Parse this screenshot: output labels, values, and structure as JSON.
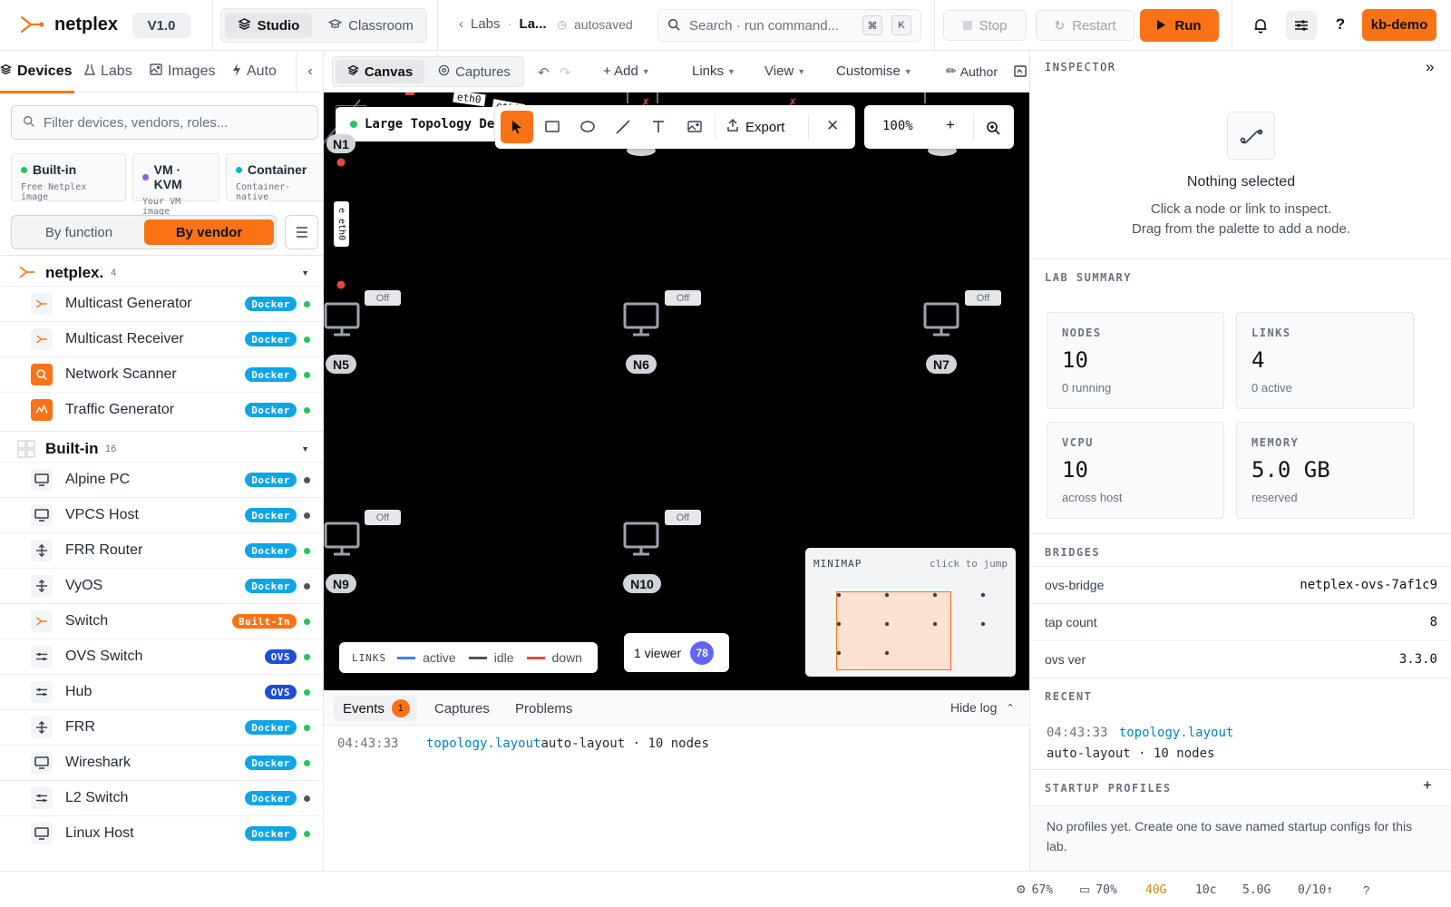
{
  "app": {
    "name": "netplex",
    "version": "V1.0"
  },
  "modes": {
    "studio": "Studio",
    "classroom": "Classroom"
  },
  "breadcrumb": {
    "labs": "Labs",
    "current": "La...",
    "saved": "autosaved"
  },
  "search": {
    "placeholder": "Search · run command...",
    "key1": "⌘",
    "key2": "K"
  },
  "controls": {
    "stop": "Stop",
    "restart": "Restart",
    "run": "Run"
  },
  "user": "kb-demo",
  "left": {
    "tabs": [
      "Devices",
      "Labs",
      "Images",
      "Auto"
    ],
    "filter_placeholder": "Filter devices, vendors, roles...",
    "chips": [
      {
        "title": "Built-in",
        "sub": "Free Netplex image",
        "color": "#22c55e"
      },
      {
        "title": "VM · KVM",
        "sub": "Your VM image",
        "color": "#8b5cf6"
      },
      {
        "title": "Container",
        "sub": "Container-native",
        "color": "#06b6d4"
      }
    ],
    "group_toggle": {
      "by_function": "By function",
      "by_vendor": "By vendor"
    },
    "groups": [
      {
        "name": "netplex.",
        "count": "4"
      },
      {
        "name": "Built-in",
        "count": "16"
      }
    ],
    "devices": [
      {
        "name": "Multicast Generator",
        "badge": "Docker",
        "status": "green"
      },
      {
        "name": "Multicast Receiver",
        "badge": "Docker",
        "status": "green"
      },
      {
        "name": "Network Scanner",
        "badge": "Docker",
        "status": "green"
      },
      {
        "name": "Traffic Generator",
        "badge": "Docker",
        "status": "green"
      },
      {
        "name": "Alpine PC",
        "badge": "Docker",
        "status": "gray"
      },
      {
        "name": "VPCS Host",
        "badge": "Docker",
        "status": "gray"
      },
      {
        "name": "FRR Router",
        "badge": "Docker",
        "status": "green"
      },
      {
        "name": "VyOS",
        "badge": "Docker",
        "status": "gray"
      },
      {
        "name": "Switch",
        "badge": "Built-In",
        "status": "green"
      },
      {
        "name": "OVS Switch",
        "badge": "OVS",
        "status": "green"
      },
      {
        "name": "Hub",
        "badge": "OVS",
        "status": "green"
      },
      {
        "name": "FRR",
        "badge": "Docker",
        "status": "green"
      },
      {
        "name": "Wireshark",
        "badge": "Docker",
        "status": "green"
      },
      {
        "name": "L2 Switch",
        "badge": "Docker",
        "status": "gray"
      },
      {
        "name": "Linux Host",
        "badge": "Docker",
        "status": "green"
      }
    ]
  },
  "canvas_bar": {
    "canvas": "Canvas",
    "captures": "Captures",
    "add": "+ Add",
    "links": "Links",
    "view": "View",
    "customise": "Customise",
    "author": "Author"
  },
  "canvas": {
    "lab_title": "Large Topology De",
    "export": "Export",
    "zoom": "100%",
    "eth_labels": [
      "eth0",
      "eth0",
      "e eth0"
    ],
    "nodes": [
      "N1",
      "N5",
      "N6",
      "N7",
      "N9",
      "N10"
    ],
    "off": "Off",
    "legend": {
      "title": "LINKS",
      "active": "active",
      "idle": "idle",
      "down": "down"
    },
    "viewer": {
      "label": "1 viewer",
      "count": "78"
    },
    "minimap": {
      "title": "MINIMAP",
      "hint": "click to jump"
    }
  },
  "log": {
    "tabs": {
      "events": "Events",
      "events_count": "1",
      "captures": "Captures",
      "problems": "Problems"
    },
    "hide": "Hide log",
    "entries": [
      {
        "time": "04:43:33",
        "topic": "topology.layout",
        "msg": "auto-layout · 10 nodes"
      }
    ]
  },
  "inspector": {
    "title": "INSPECTOR",
    "empty_title": "Nothing selected",
    "empty_line1": "Click a node or link to inspect.",
    "empty_line2": "Drag from the palette to add a node."
  },
  "summary": {
    "title": "LAB SUMMARY",
    "cards": [
      {
        "k": "NODES",
        "v": "10",
        "s": "0 running"
      },
      {
        "k": "LINKS",
        "v": "4",
        "s": "0 active"
      },
      {
        "k": "VCPU",
        "v": "10",
        "s": "across host"
      },
      {
        "k": "MEMORY",
        "v": "5.0 GB",
        "s": "reserved"
      }
    ]
  },
  "bridges": {
    "title": "BRIDGES",
    "rows": [
      {
        "k": "ovs-bridge",
        "v": "netplex-ovs-7af1c9"
      },
      {
        "k": "tap count",
        "v": "8"
      },
      {
        "k": "ovs ver",
        "v": "3.3.0"
      }
    ]
  },
  "recent": {
    "title": "RECENT",
    "time": "04:43:33",
    "topic": "topology.layout",
    "msg": "auto-layout · 10 nodes"
  },
  "profiles": {
    "title": "STARTUP PROFILES",
    "add": "+",
    "empty": "No profiles yet. Create one to save named startup configs for this lab."
  },
  "status": {
    "cpu": "67%",
    "mem": "70%",
    "disk": "40G",
    "cores": "10c",
    "ram": "5.0G",
    "net": "0/10↑",
    "help": "?"
  },
  "colors": {
    "accent": "#f97316",
    "docker": "#0ea5e9",
    "ovs": "#1d4ed8",
    "online": "#22c55e",
    "down": "#ef4444"
  }
}
